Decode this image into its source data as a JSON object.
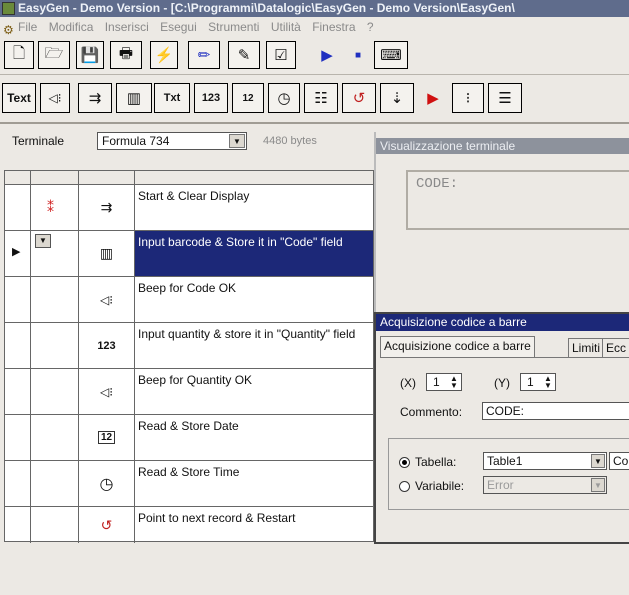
{
  "window": {
    "title": "EasyGen - Demo Version - [C:\\Programmi\\Datalogic\\EasyGen - Demo Version\\EasyGen\\"
  },
  "menu": [
    "File",
    "Modifica",
    "Inserisci",
    "Esegui",
    "Strumenti",
    "Utilità",
    "Finestra",
    "?"
  ],
  "toolbar1": [
    {
      "icon": "new-file-icon",
      "glyph": "🗋"
    },
    {
      "icon": "open-folder-icon",
      "glyph": "🗁"
    },
    {
      "icon": "save-icon",
      "glyph": "💾"
    },
    {
      "icon": "print-icon",
      "glyph": "🖶"
    },
    {
      "icon": "lightning-icon",
      "glyph": "⚡"
    },
    {
      "icon": "edit-icon",
      "glyph": "✏"
    },
    {
      "icon": "edit-doc-icon",
      "glyph": "✎"
    },
    {
      "icon": "check-doc-icon",
      "glyph": "☑"
    },
    {
      "icon": "play-icon",
      "glyph": "▶"
    },
    {
      "icon": "stop-icon",
      "glyph": "■"
    },
    {
      "icon": "terminal-icon",
      "glyph": "⌨"
    }
  ],
  "toolbar2": [
    {
      "icon": "text-icon",
      "glyph": "Text"
    },
    {
      "icon": "beep-icon",
      "glyph": "◁⁝"
    },
    {
      "icon": "clear-display-icon",
      "glyph": "⇉"
    },
    {
      "icon": "barcode-icon",
      "glyph": "▥"
    },
    {
      "icon": "text-input-icon",
      "glyph": "Txt"
    },
    {
      "icon": "numeric-input-icon",
      "glyph": "123"
    },
    {
      "icon": "calendar-icon",
      "glyph": "12"
    },
    {
      "icon": "clock-icon",
      "glyph": "◷"
    },
    {
      "icon": "list-icon",
      "glyph": "☷"
    },
    {
      "icon": "loop-icon",
      "glyph": "↺"
    },
    {
      "icon": "download-icon",
      "glyph": "⇣"
    },
    {
      "icon": "run-icon",
      "glyph": "▶"
    },
    {
      "icon": "sort-icon",
      "glyph": "⁝"
    },
    {
      "icon": "checklist-icon",
      "glyph": "☰"
    }
  ],
  "terminal": {
    "label": "Terminale",
    "value": "Formula 734",
    "bytes": "4480 bytes"
  },
  "steps": [
    {
      "icon": "clear-display-icon",
      "glyph": "⇉",
      "text": "Start & Clear Display",
      "selected": false
    },
    {
      "icon": "barcode-icon",
      "glyph": "▥",
      "text": "Input barcode & Store it in \"Code\" field",
      "selected": true
    },
    {
      "icon": "beep-icon",
      "glyph": "◁⁝",
      "text": "Beep for Code OK",
      "selected": false
    },
    {
      "icon": "numeric-input-icon",
      "glyph": "123",
      "text": "Input quantity & store it in \"Quantity\" field",
      "selected": false
    },
    {
      "icon": "beep-icon",
      "glyph": "◁⁝",
      "text": "Beep for Quantity OK",
      "selected": false
    },
    {
      "icon": "calendar-icon",
      "glyph": "12",
      "text": "Read & Store Date",
      "selected": false
    },
    {
      "icon": "clock-icon",
      "glyph": "◷",
      "text": "Read & Store Time",
      "selected": false
    },
    {
      "icon": "loop-icon",
      "glyph": "↺",
      "text": "Point to next record & Restart",
      "selected": false
    }
  ],
  "visualizzazione": {
    "title": "Visualizzazione terminale",
    "screen_text": "CODE:"
  },
  "dialog": {
    "title": "Acquisizione codice a barre",
    "tabs": [
      "Acquisizione codice a barre",
      "Limiti",
      "Ecc"
    ],
    "x_label": "(X)",
    "x_value": "1",
    "y_label": "(Y)",
    "y_value": "1",
    "comment_label": "Commento:",
    "comment_value": "CODE:",
    "table_label": "Tabella:",
    "table_value": "Table1",
    "table_extra": "Co",
    "var_label": "Variabile:",
    "var_value": "Error"
  },
  "colors": {
    "selection": "#1c2878",
    "title_bar": "#5f6c8c"
  }
}
